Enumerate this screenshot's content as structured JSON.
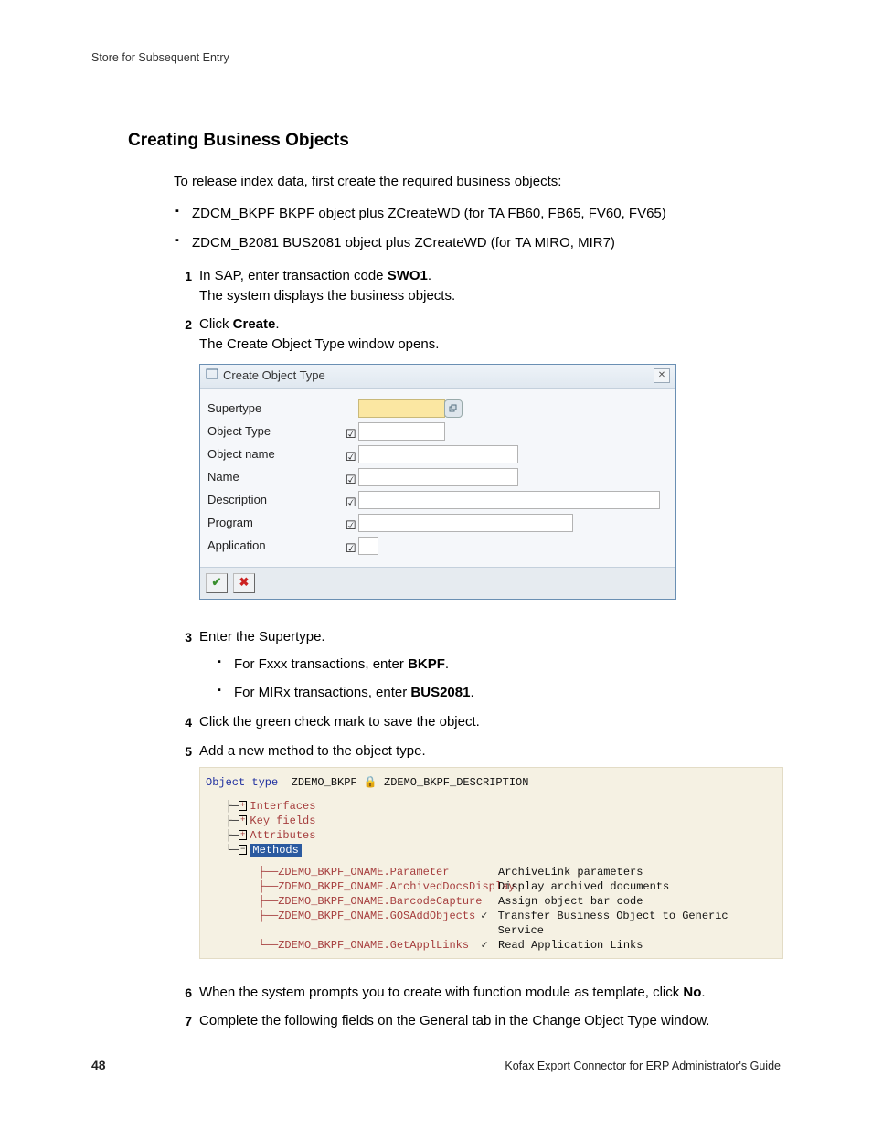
{
  "running_header": "Store for Subsequent Entry",
  "section_title": "Creating Business Objects",
  "intro": "To release index data, first create the required business objects:",
  "required_objects": [
    "ZDCM_BKPF BKPF object plus ZCreateWD (for TA FB60, FB65, FV60, FV65)",
    "ZDCM_B2081 BUS2081 object plus ZCreateWD (for TA MIRO, MIR7)"
  ],
  "steps": {
    "s1": {
      "num": "1",
      "line1_pre": "In SAP, enter transaction code ",
      "line1_bold": "SWO1",
      "line1_post": ".",
      "line2": "The system displays the business objects."
    },
    "s2": {
      "num": "2",
      "line1_pre": "Click ",
      "line1_bold": "Create",
      "line1_post": ".",
      "line2": "The Create Object Type window opens."
    },
    "s3": {
      "num": "3",
      "line1": "Enter the Supertype.",
      "sub": [
        {
          "pre": "For Fxxx transactions, enter ",
          "bold": "BKPF",
          "post": "."
        },
        {
          "pre": "For MIRx transactions, enter ",
          "bold": "BUS2081",
          "post": "."
        }
      ]
    },
    "s4": {
      "num": "4",
      "text": "Click the green check mark to save the object."
    },
    "s5": {
      "num": "5",
      "text": "Add a new method to the object type."
    },
    "s6": {
      "num": "6",
      "pre": "When the system prompts you to create with function module as template, click ",
      "bold": "No",
      "post": "."
    },
    "s7": {
      "num": "7",
      "text": "Complete the following fields on the General tab in the Change Object Type window."
    }
  },
  "sap_dialog": {
    "title": "Create Object Type",
    "fields": {
      "supertype": "Supertype",
      "object_type": "Object Type",
      "object_name": "Object name",
      "name": "Name",
      "description": "Description",
      "program": "Program",
      "application": "Application"
    }
  },
  "bob": {
    "label": "Object type",
    "objtype": "ZDEMO_BKPF",
    "lock": "🔒",
    "objdesc": "ZDEMO_BKPF_DESCRIPTION",
    "nodes": {
      "interfaces": "Interfaces",
      "keyfields": "Key fields",
      "attributes": "Attributes",
      "methods": "Methods"
    },
    "methods": [
      {
        "name": "ZDEMO_BKPF_ONAME.Parameter",
        "mark": "",
        "desc": "ArchiveLink parameters"
      },
      {
        "name": "ZDEMO_BKPF_ONAME.ArchivedDocsDisplay",
        "mark": "",
        "desc": "Display archived documents"
      },
      {
        "name": "ZDEMO_BKPF_ONAME.BarcodeCapture",
        "mark": "",
        "desc": "Assign object bar code"
      },
      {
        "name": "ZDEMO_BKPF_ONAME.GOSAddObjects",
        "mark": "✓",
        "desc": "Transfer Business Object to Generic Service"
      },
      {
        "name": "ZDEMO_BKPF_ONAME.GetApplLinks",
        "mark": "✓",
        "desc": "Read Application Links"
      }
    ]
  },
  "footer": {
    "page": "48",
    "doc": "Kofax Export Connector for ERP Administrator's Guide"
  }
}
